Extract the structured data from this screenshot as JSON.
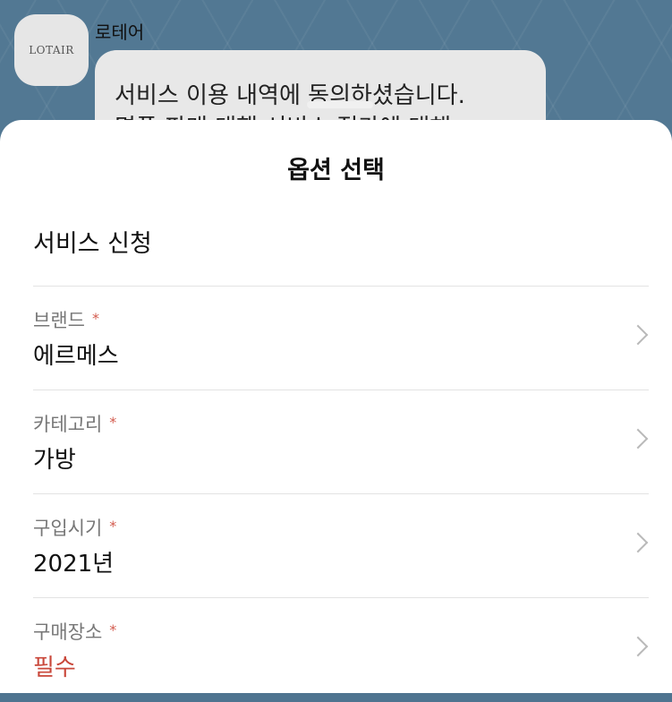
{
  "chat": {
    "avatar_text": "LOTAIR",
    "sender": "로테어",
    "message_line1": "서비스 이용 내역에 동의하셨습니다.",
    "message_line2": "명품 판매 대행 서비스 접가에 대해"
  },
  "sheet": {
    "title": "옵션 선택",
    "section_title": "서비스 신청",
    "required_mark": "*",
    "rows": [
      {
        "label": "브랜드",
        "value": "에르메스"
      },
      {
        "label": "카테고리",
        "value": "가방"
      },
      {
        "label": "구입시기",
        "value": "2021년"
      },
      {
        "label": "구매장소",
        "value": "필수"
      }
    ]
  },
  "colors": {
    "chat_background": "#527893",
    "required_accent": "#c9473a"
  }
}
